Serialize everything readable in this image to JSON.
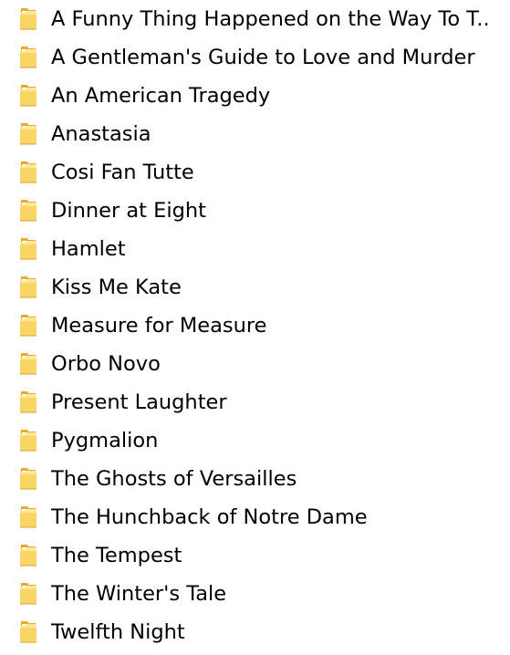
{
  "folders": [
    {
      "label": "A Funny Thing Happened on the Way To T..",
      "icon": "folder-icon"
    },
    {
      "label": "A Gentleman's Guide to Love and Murder",
      "icon": "folder-icon"
    },
    {
      "label": "An American Tragedy",
      "icon": "folder-icon"
    },
    {
      "label": "Anastasia",
      "icon": "folder-icon"
    },
    {
      "label": "Cosi Fan Tutte",
      "icon": "folder-icon"
    },
    {
      "label": "Dinner at Eight",
      "icon": "folder-icon"
    },
    {
      "label": "Hamlet",
      "icon": "folder-icon"
    },
    {
      "label": "Kiss Me Kate",
      "icon": "folder-icon"
    },
    {
      "label": "Measure for Measure",
      "icon": "folder-icon"
    },
    {
      "label": "Orbo Novo",
      "icon": "folder-icon"
    },
    {
      "label": "Present Laughter",
      "icon": "folder-icon"
    },
    {
      "label": "Pygmalion",
      "icon": "folder-icon"
    },
    {
      "label": "The Ghosts of Versailles",
      "icon": "folder-icon"
    },
    {
      "label": "The Hunchback of Notre Dame",
      "icon": "folder-icon"
    },
    {
      "label": "The Tempest",
      "icon": "folder-icon"
    },
    {
      "label": "The Winter's Tale",
      "icon": "folder-icon"
    },
    {
      "label": "Twelfth Night",
      "icon": "folder-icon"
    }
  ],
  "colors": {
    "folder_back": "#e8a92c",
    "folder_front": "#f8d565",
    "folder_front_light": "#fde79a",
    "text": "#000000",
    "background": "#ffffff"
  }
}
